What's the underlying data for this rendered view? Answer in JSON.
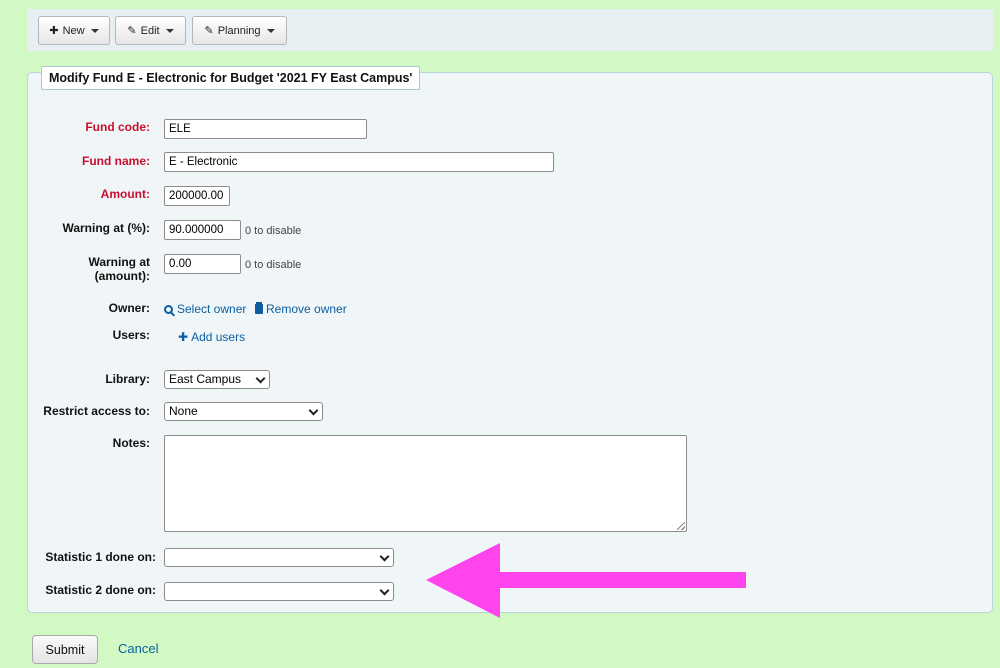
{
  "toolbar": {
    "new_label": "New",
    "edit_label": "Edit",
    "planning_label": "Planning"
  },
  "form": {
    "legend": "Modify Fund E - Electronic for Budget '2021 FY East Campus'",
    "fund_code": {
      "label": "Fund code:",
      "value": "ELE"
    },
    "fund_name": {
      "label": "Fund name:",
      "value": "E - Electronic"
    },
    "amount": {
      "label": "Amount:",
      "value": "200000.00"
    },
    "warning_pct": {
      "label": "Warning at (%):",
      "value": "90.000000",
      "hint": "0 to disable"
    },
    "warning_amt": {
      "label_line1": "Warning at",
      "label_line2": "(amount):",
      "value": "0.00",
      "hint": "0 to disable"
    },
    "owner": {
      "label": "Owner:",
      "select_link": "Select owner",
      "remove_link": "Remove owner"
    },
    "users": {
      "label": "Users:",
      "add_link": "Add users"
    },
    "library": {
      "label": "Library:",
      "value": "East Campus"
    },
    "restrict": {
      "label": "Restrict access to:",
      "value": "None"
    },
    "notes": {
      "label": "Notes:",
      "value": ""
    },
    "stat1": {
      "label": "Statistic 1 done on:",
      "value": ""
    },
    "stat2": {
      "label": "Statistic 2 done on:",
      "value": ""
    }
  },
  "actions": {
    "submit_label": "Submit",
    "cancel_label": "Cancel"
  },
  "annotation": {
    "arrow_color": "#ff44ee"
  }
}
